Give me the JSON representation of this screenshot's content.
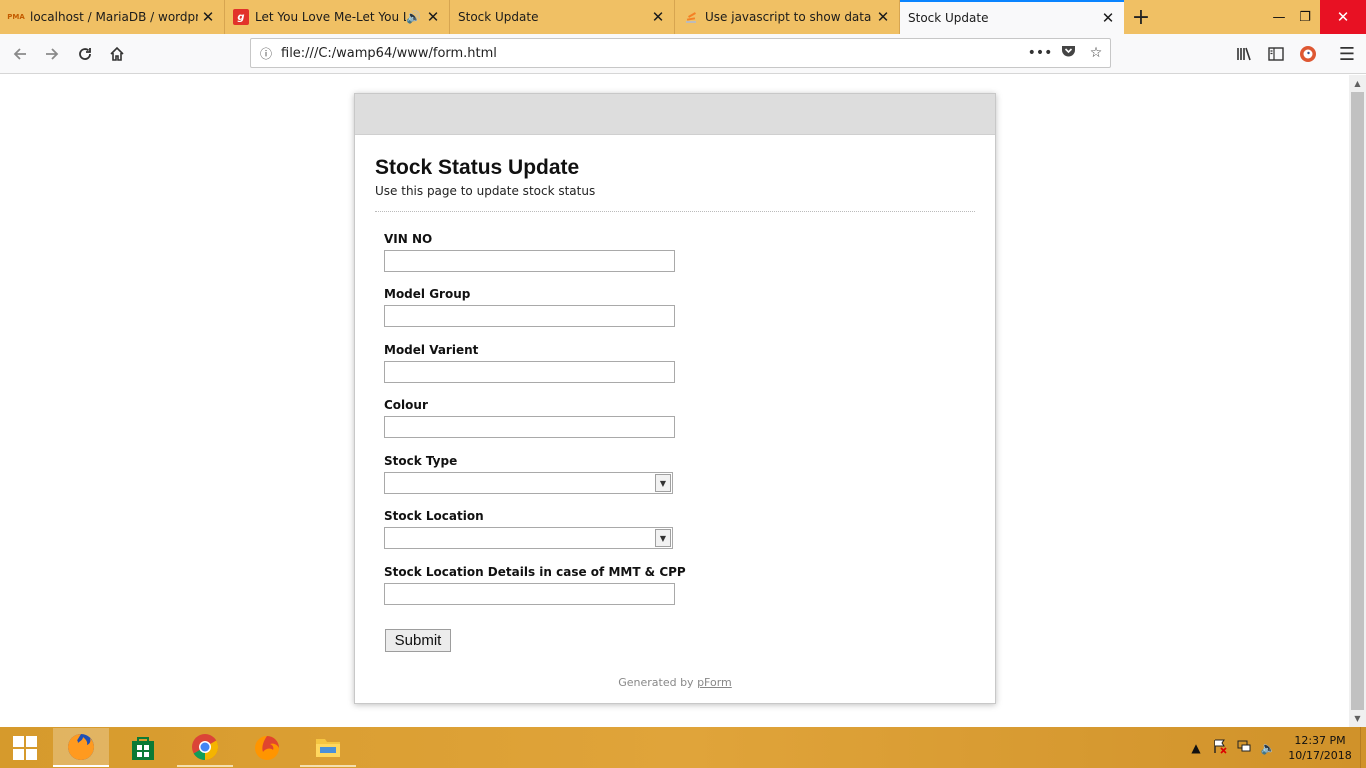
{
  "tabs": [
    {
      "title": "localhost / MariaDB / wordpres",
      "favicon": "pma",
      "active": false
    },
    {
      "title": "Let You Love Me-Let You Lo",
      "favicon": "g",
      "active": false,
      "sound": true
    },
    {
      "title": "Stock Update",
      "favicon": "",
      "active": false
    },
    {
      "title": "Use javascript to show data fro",
      "favicon": "so",
      "active": false
    },
    {
      "title": "Stock Update",
      "favicon": "",
      "active": true
    }
  ],
  "favicons": {
    "pma": "PMA",
    "g": "g"
  },
  "urlbar": {
    "url": "file:///C:/wamp64/www/form.html"
  },
  "form": {
    "title": "Stock Status Update",
    "description": "Use this page to update stock status",
    "fields": {
      "vin": "VIN NO",
      "model_group": "Model Group",
      "model_variant": "Model Varient",
      "colour": "Colour",
      "stock_type": "Stock Type",
      "stock_location": "Stock Location",
      "location_details": "Stock Location Details in case of MMT & CPP"
    },
    "submit_label": "Submit",
    "footer_prefix": "Generated by",
    "footer_link": "pForm"
  },
  "taskbar": {
    "apps": [
      "firefox",
      "store",
      "chrome",
      "firefox-dev",
      "file-explorer"
    ]
  },
  "clock": {
    "time": "12:37 PM",
    "date": "10/17/2018"
  },
  "colors": {
    "tab_bar": "#f0c064",
    "active_tab_accent": "#0a84ff",
    "taskbar": "#d69a2c",
    "close_window": "#e81123"
  }
}
